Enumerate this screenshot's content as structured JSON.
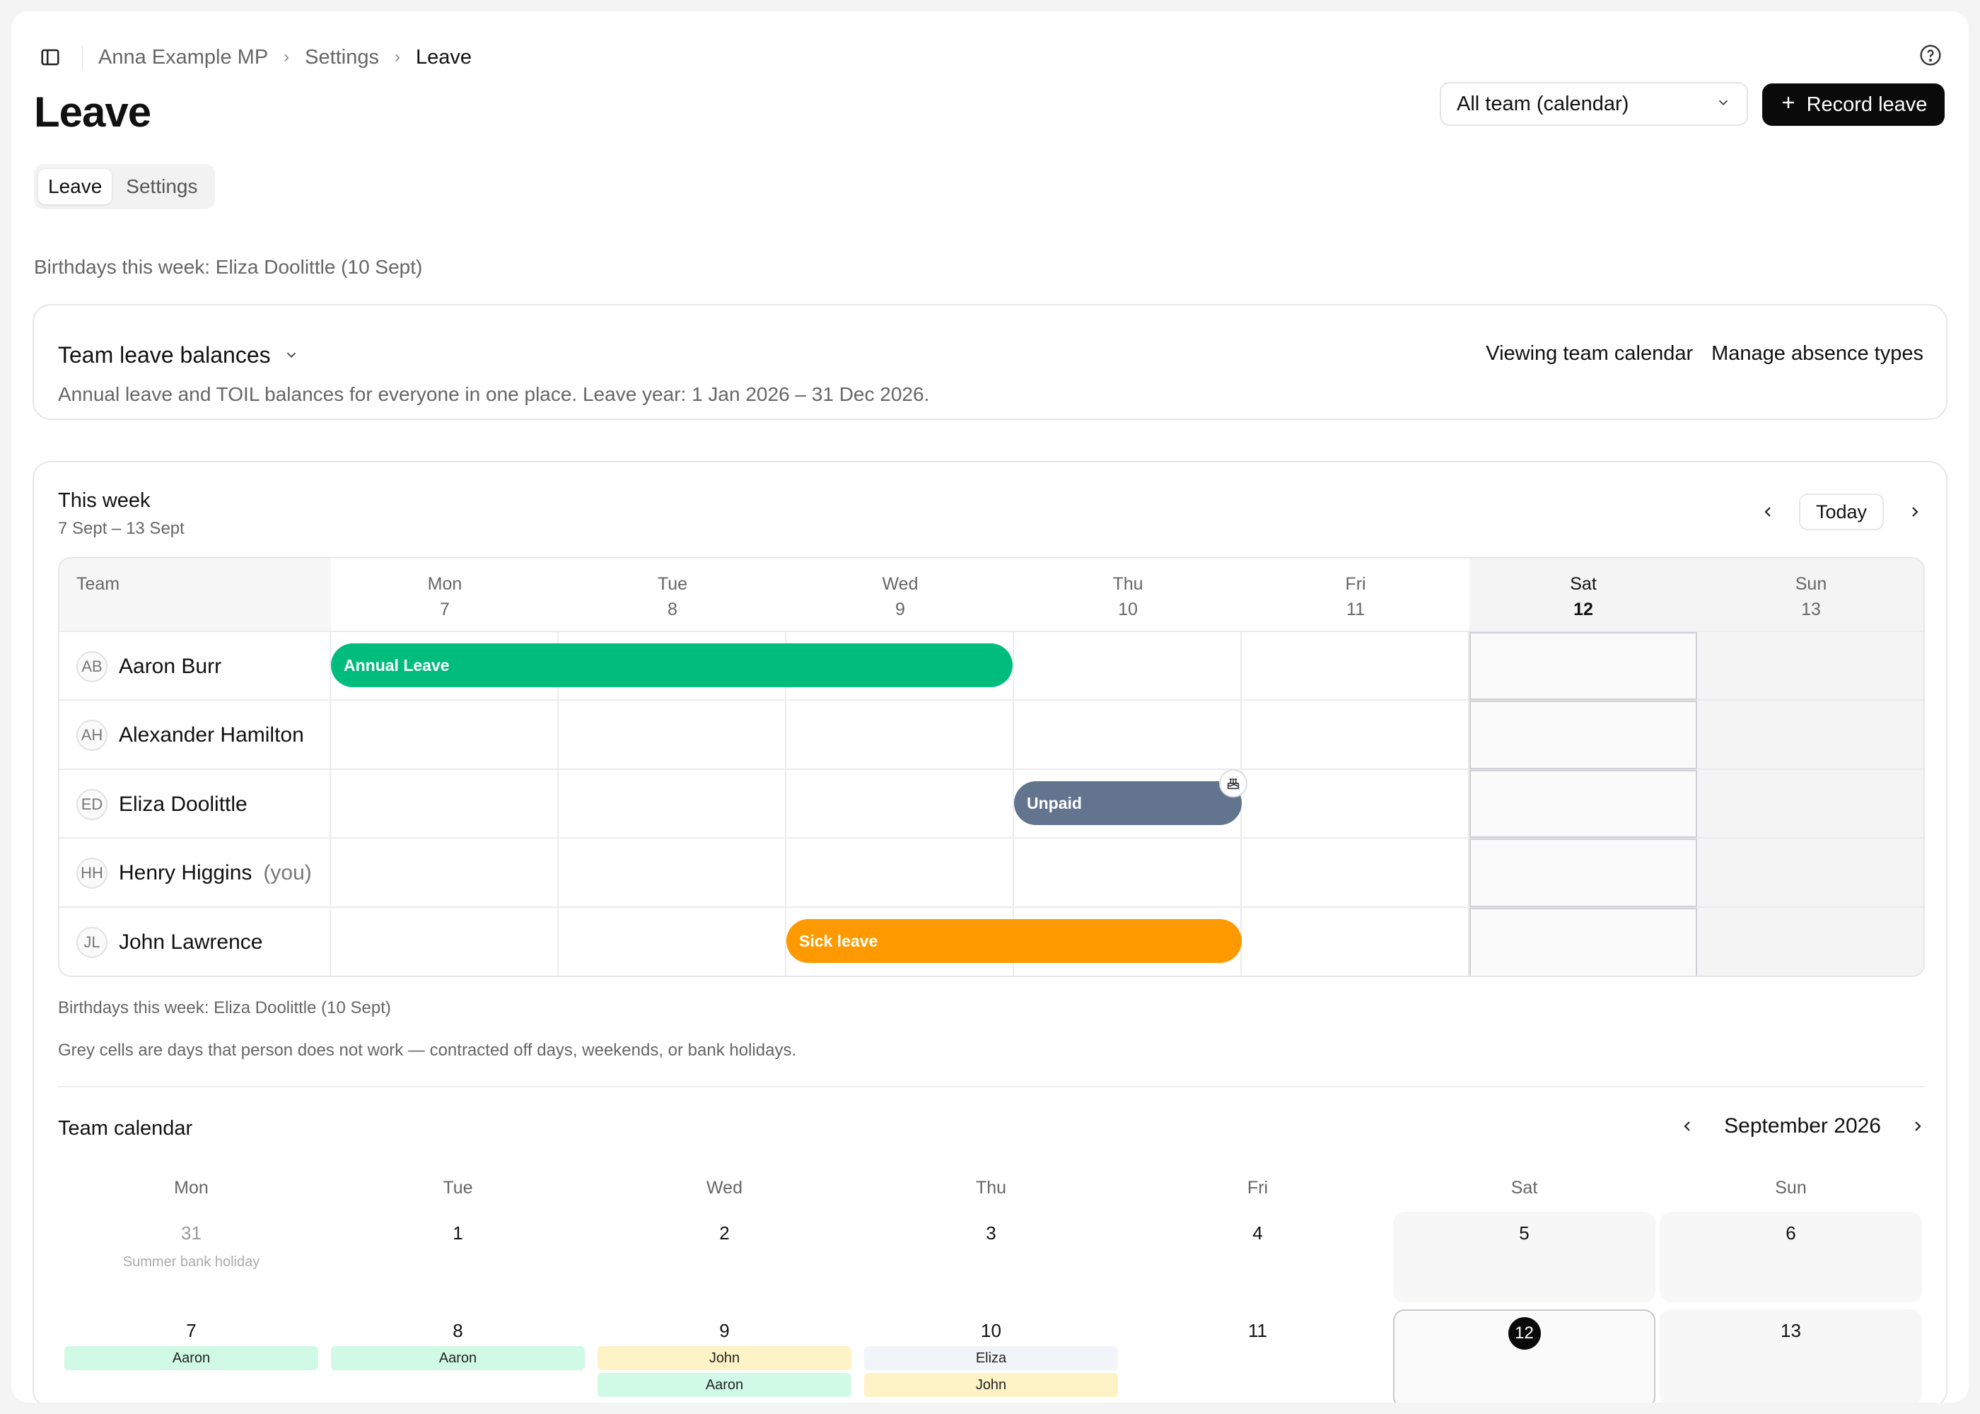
{
  "breadcrumb": {
    "items": [
      "Anna Example MP",
      "Settings",
      "Leave"
    ]
  },
  "page": {
    "title": "Leave"
  },
  "filter": {
    "selected": "All team (calendar)"
  },
  "record_button": {
    "label": "Record leave"
  },
  "tabs": [
    "Leave",
    "Settings"
  ],
  "birthdays_note": "Birthdays this week: Eliza Doolittle (10 Sept)",
  "balances": {
    "title": "Team leave balances",
    "description": "Annual leave and TOIL balances for everyone in one place. Leave year: 1 Jan 2026 – 31 Dec 2026.",
    "link_viewing": "Viewing team calendar",
    "link_manage": "Manage absence types"
  },
  "week": {
    "title": "This week",
    "range": "7 Sept – 13 Sept",
    "today_label": "Today",
    "team_header": "Team",
    "days": [
      {
        "name": "Mon",
        "num": "7"
      },
      {
        "name": "Tue",
        "num": "8"
      },
      {
        "name": "Wed",
        "num": "9"
      },
      {
        "name": "Thu",
        "num": "10"
      },
      {
        "name": "Fri",
        "num": "11"
      },
      {
        "name": "Sat",
        "num": "12"
      },
      {
        "name": "Sun",
        "num": "13"
      }
    ],
    "people": [
      {
        "initials": "AB",
        "name": "Aaron Burr",
        "suffix": ""
      },
      {
        "initials": "AH",
        "name": "Alexander Hamilton",
        "suffix": ""
      },
      {
        "initials": "ED",
        "name": "Eliza Doolittle",
        "suffix": ""
      },
      {
        "initials": "HH",
        "name": "Henry Higgins",
        "suffix": "(you)"
      },
      {
        "initials": "JL",
        "name": "John Lawrence",
        "suffix": ""
      }
    ],
    "leave": {
      "annual": "Annual Leave",
      "unpaid": "Unpaid",
      "sick": "Sick leave"
    },
    "birthdays_note": "Birthdays this week: Eliza Doolittle (10 Sept)",
    "grey_note": "Grey cells are days that person does not work — contracted off days, weekends, or bank holidays."
  },
  "colors": {
    "annual": "#00bc7d",
    "unpaid": "#62748e",
    "sick": "#fe9a00"
  },
  "calendar": {
    "title": "Team calendar",
    "month": "September 2026",
    "weekdays": [
      "Mon",
      "Tue",
      "Wed",
      "Thu",
      "Fri",
      "Sat",
      "Sun"
    ],
    "row1": [
      "31",
      "1",
      "2",
      "3",
      "4",
      "5",
      "6"
    ],
    "holiday": "Summer bank holiday",
    "row2": [
      "7",
      "8",
      "9",
      "10",
      "11",
      "12",
      "13"
    ],
    "chips": {
      "mon": "Aaron",
      "tue": "Aaron",
      "wed1": "John",
      "wed2": "Aaron",
      "thu1": "Eliza",
      "thu2": "John"
    }
  }
}
